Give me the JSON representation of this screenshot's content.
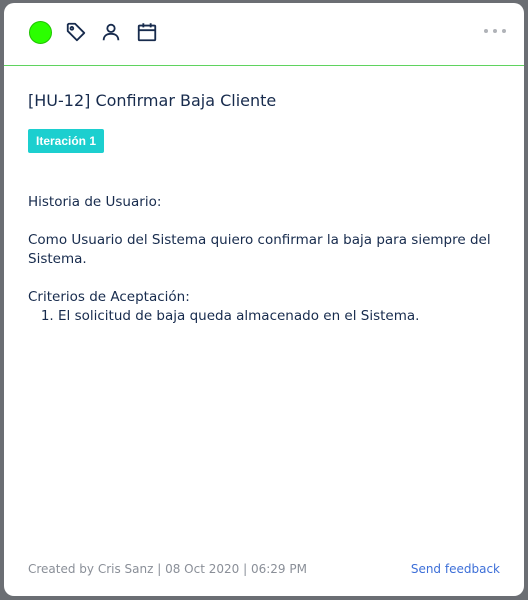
{
  "toolbar": {
    "status_color": "#2bff00",
    "icons": [
      "status-dot",
      "tag-icon",
      "user-icon",
      "calendar-icon",
      "more-icon"
    ]
  },
  "card": {
    "title": "[HU-12] Confirmar Baja Cliente",
    "badge": "Iteración 1",
    "badge_color": "#1ccfcf",
    "description": {
      "heading": "Historia de Usuario:",
      "story": "Como Usuario del Sistema quiero confirmar la baja para siempre del Sistema.",
      "criteria_heading": "Criterios de Aceptación:",
      "criteria": [
        "El solicitud de baja queda almacenado en el Sistema."
      ]
    }
  },
  "footer": {
    "meta": "Created by Cris Sanz | 08 Oct 2020 | 06:29 PM",
    "feedback_link": "Send feedback"
  }
}
